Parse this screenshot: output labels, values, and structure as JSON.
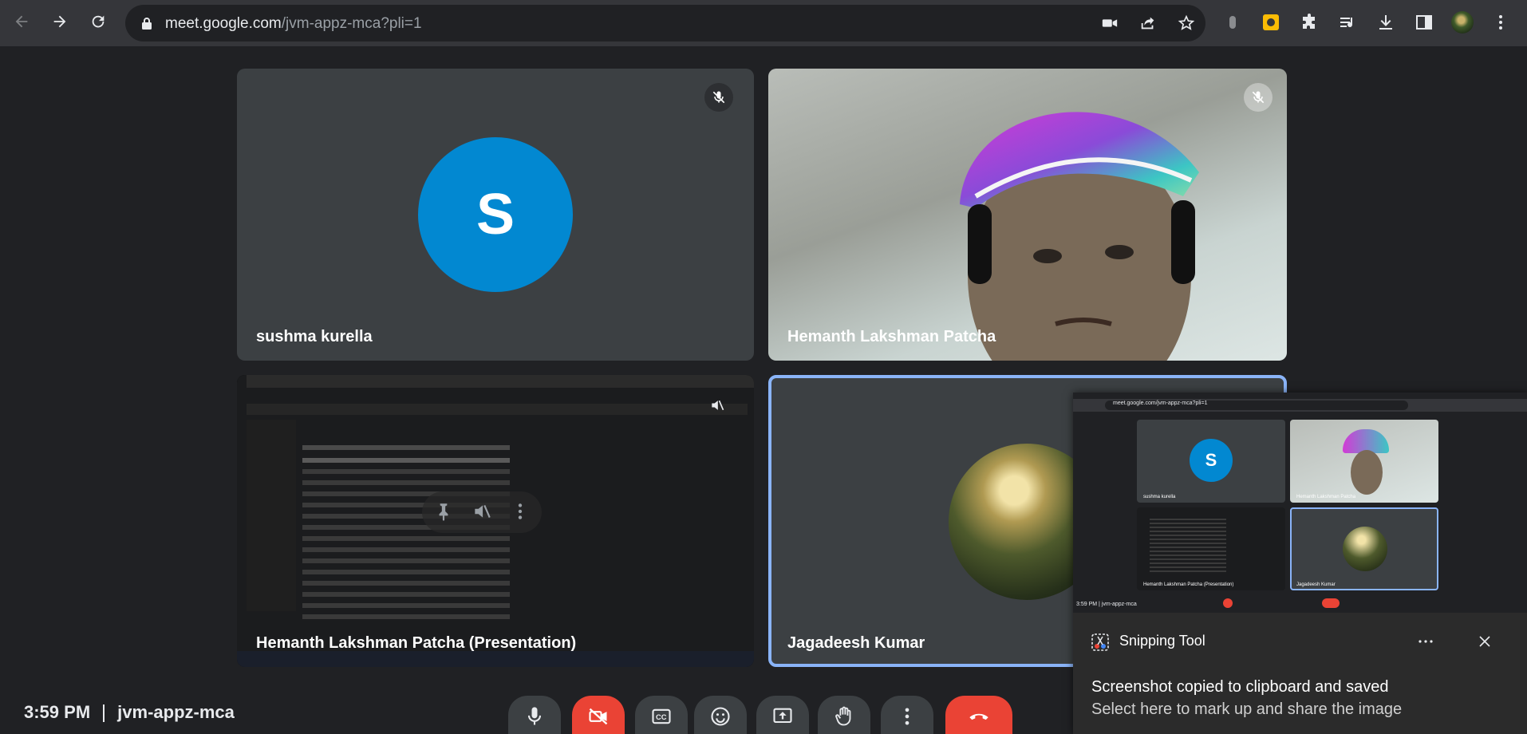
{
  "browser": {
    "url_host": "meet.google.com",
    "url_path": "/jvm-appz-mca?pli=1"
  },
  "tiles": [
    {
      "name": "sushma kurella",
      "initial": "S"
    },
    {
      "name": "Hemanth Lakshman Patcha"
    },
    {
      "name": "Hemanth Lakshman Patcha (Presentation)"
    },
    {
      "name": "Jagadeesh Kumar"
    }
  ],
  "footer": {
    "time": "3:59 PM",
    "meeting_code": "jvm-appz-mca"
  },
  "snipping": {
    "app_name": "Snipping Tool",
    "line1": "Screenshot copied to clipboard and saved",
    "line2": "Select here to mark up and share the image",
    "preview": {
      "url": "meet.google.com/jvm-appz-mca?pli=1",
      "time_code": "3:59 PM | jvm-appz-mca",
      "tiles": [
        "sushma kurella",
        "Hemanth Lakshman Patcha",
        "Hemanth Lakshman Patcha (Presentation)",
        "Jagadeesh Kumar"
      ],
      "initial": "S"
    }
  },
  "colors": {
    "page_bg": "#202124",
    "tile_bg": "#3c4043",
    "avatar_blue": "#0288d1",
    "danger_red": "#ea4335",
    "active_blue": "#8ab4f8"
  }
}
